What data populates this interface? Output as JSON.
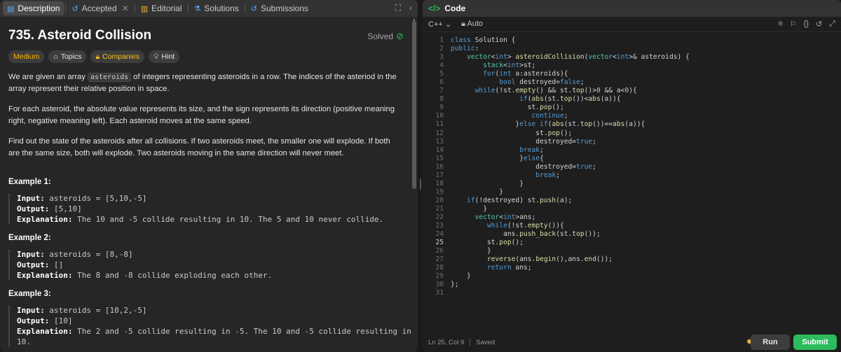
{
  "tabs": [
    {
      "label": "Description",
      "icon": "description-icon"
    },
    {
      "label": "Accepted",
      "icon": "accepted-icon"
    },
    {
      "label": "Editorial",
      "icon": "editorial-icon"
    },
    {
      "label": "Solutions",
      "icon": "solutions-icon"
    },
    {
      "label": "Submissions",
      "icon": "submissions-icon"
    }
  ],
  "problem": {
    "title": "735. Asteroid Collision",
    "status": "Solved",
    "tags": [
      "Medium",
      "Topics",
      "Companies",
      "Hint"
    ],
    "desc1_pre": "We are given an array ",
    "desc1_code": "asteroids",
    "desc1_post": " of integers representing asteroids in a row. The indices of the asteriod in the array represent their relative position in space.",
    "desc2": "For each asteroid, the absolute value represents its size, and the sign represents its direction (positive meaning right, negative meaning left). Each asteroid moves at the same speed.",
    "desc3": "Find out the state of the asteroids after all collisions. If two asteroids meet, the smaller one will explode. If both are the same size, both will explode. Two asteroids moving in the same direction will never meet.",
    "examples": [
      {
        "title": "Example 1:",
        "input_label": "Input:",
        "input": " asteroids = [5,10,-5]",
        "output_label": "Output:",
        "output": " [5,10]",
        "expl_label": "Explanation:",
        "expl": " The 10 and -5 collide resulting in 10. The 5 and 10 never collide."
      },
      {
        "title": "Example 2:",
        "input_label": "Input:",
        "input": " asteroids = [8,-8]",
        "output_label": "Output:",
        "output": " []",
        "expl_label": "Explanation:",
        "expl": " The 8 and -8 collide exploding each other."
      },
      {
        "title": "Example 3:",
        "input_label": "Input:",
        "input": " asteroids = [10,2,-5]",
        "output_label": "Output:",
        "output": " [10]",
        "expl_label": "Explanation:",
        "expl": " The 2 and -5 collide resulting in -5. The 10 and -5 collide resulting in 10."
      }
    ]
  },
  "editor": {
    "title": "Code",
    "language": "C++",
    "mode": "Auto",
    "cursor": "Ln 25, Col 9",
    "save_state": "Saved",
    "run_label": "Run",
    "submit_label": "Submit",
    "lines": [
      "class Solution {",
      "public:",
      "    vector<int> asteroidCollision(vector<int>& asteroids) {",
      "        stack<int>st;",
      "        for(int a:asteroids){",
      "            bool destroyed=false;",
      "      while(!st.empty() && st.top()>0 && a<0){",
      "                 if(abs(st.top())<abs(a)){",
      "                   st.pop();",
      "                    continue;",
      "                }else if(abs(st.top())==abs(a)){",
      "                     st.pop();",
      "                     destroyed=true;",
      "                 break;",
      "                 }else{",
      "                     destroyed=true;",
      "                     break;",
      "                 }",
      "            }",
      "    if(!destroyed) st.push(a);",
      "        }",
      "      vector<int>ans;",
      "         while(!st.empty()){",
      "             ans.push_back(st.top());",
      "         st.pop();",
      "         }",
      "         reverse(ans.begin(),ans.end());",
      "         return ans;",
      "    }",
      "};",
      ""
    ]
  }
}
